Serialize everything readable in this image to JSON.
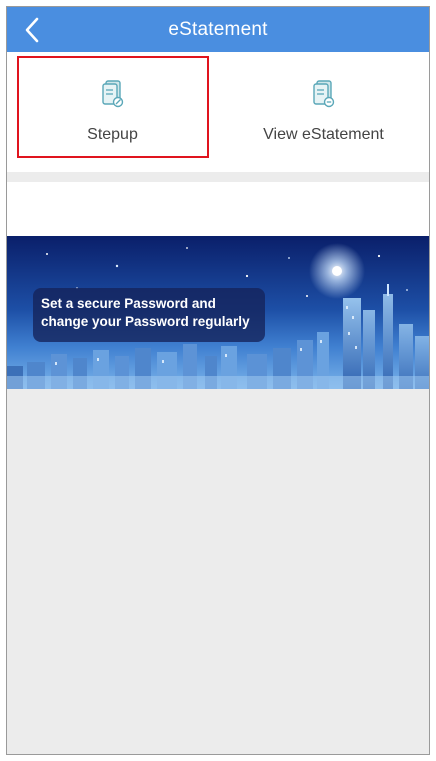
{
  "header": {
    "title": "eStatement",
    "back_icon": "chevron-left-icon"
  },
  "tiles": [
    {
      "label": "Stepup",
      "icon": "document-edit-icon",
      "selected": true
    },
    {
      "label": "View eStatement",
      "icon": "document-view-icon",
      "selected": false
    }
  ],
  "banner": {
    "line1": "Set a secure Password and",
    "line2": "change your Password regularly"
  },
  "colors": {
    "header_bg": "#4a8ee0",
    "icon": "#5aa7b8",
    "highlight": "#e0141e",
    "page_bg": "#ececec"
  }
}
